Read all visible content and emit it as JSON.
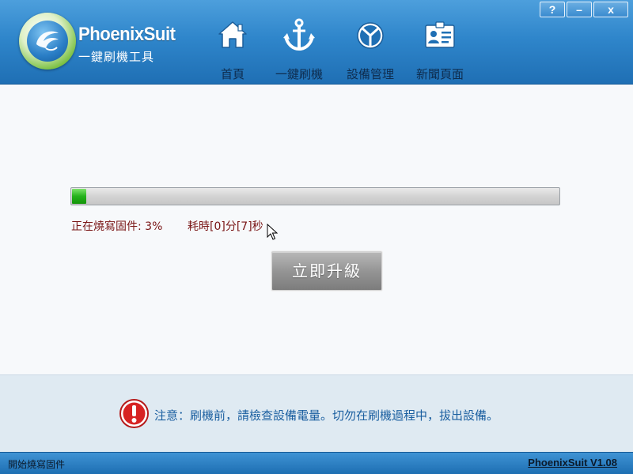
{
  "header": {
    "app_name": "PhoenixSuit",
    "app_subtitle": "一鍵刷機工具",
    "nav": [
      {
        "label": "首頁",
        "icon": "home-icon"
      },
      {
        "label": "一鍵刷機",
        "icon": "anchor-icon"
      },
      {
        "label": "設備管理",
        "icon": "device-icon"
      },
      {
        "label": "新聞頁面",
        "icon": "news-card-icon"
      }
    ],
    "window_controls": {
      "help": "?",
      "minimize": "–",
      "close": "x"
    }
  },
  "main": {
    "progress": {
      "percent": 3,
      "fill_color": "#25b21c"
    },
    "status_text": "正在燒寫固件: 3%",
    "elapsed_text": "耗時[0]分[7]秒",
    "upgrade_button": "立即升級"
  },
  "notice": {
    "icon": "warning-icon",
    "text": "注意：刷機前，請檢查設備電量。切勿在刷機過程中，拔出設備。"
  },
  "statusbar": {
    "left_text": "開始燒寫固件",
    "version": "PhoenixSuit V1.08"
  },
  "colors": {
    "header_blue": "#2f86cb",
    "status_red": "#7a1616",
    "notice_blue": "#1b5fa0",
    "notice_bg": "#dfeaf2"
  }
}
